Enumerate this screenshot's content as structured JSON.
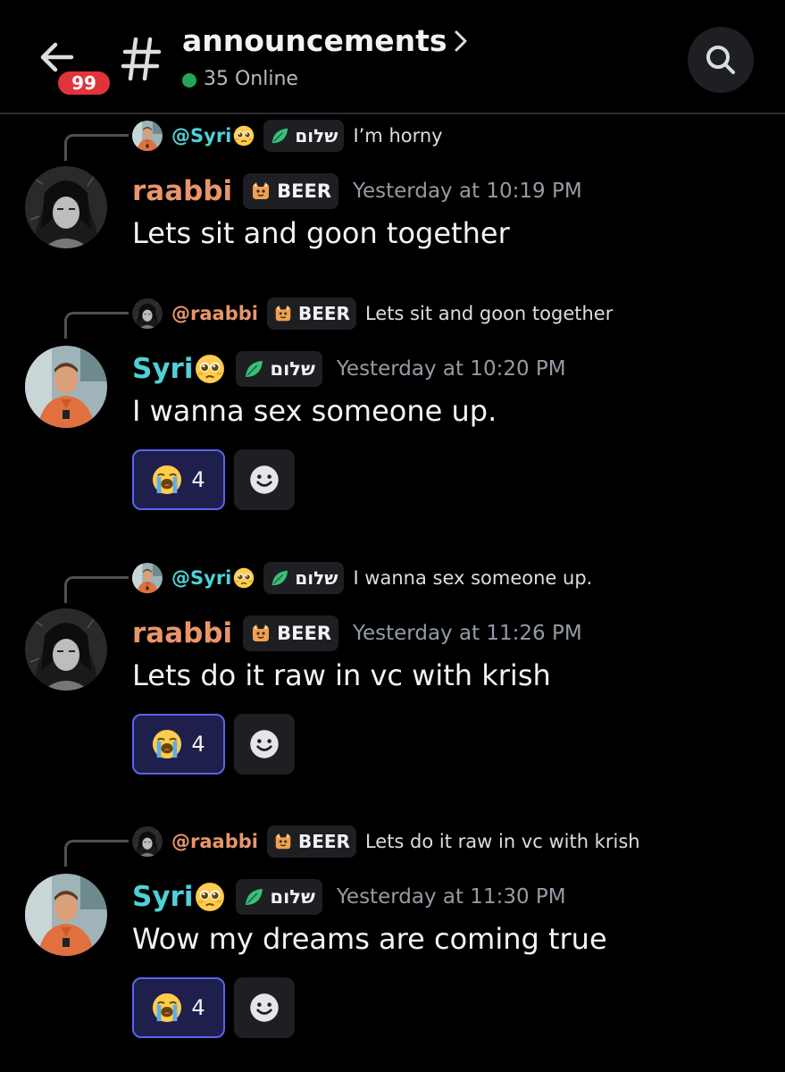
{
  "header": {
    "channel_name": "announcements",
    "online_text": "35 Online",
    "unread_badge": "99"
  },
  "messages": [
    {
      "reply_to": {
        "name": "@Syri",
        "tag": "שלום",
        "text": "I’m horny"
      },
      "author": "raabbi",
      "tag": "BEER",
      "timestamp": "Yesterday at 10:19 PM",
      "content": "Lets sit and goon together"
    },
    {
      "reply_to": {
        "name": "@raabbi",
        "tag": "BEER",
        "text": "Lets sit and goon together"
      },
      "author": "Syri",
      "tag": "שלום",
      "timestamp": "Yesterday at 10:20 PM",
      "content": "I wanna sex someone up.",
      "reaction_count": "4"
    },
    {
      "reply_to": {
        "name": "@Syri",
        "tag": "שלום",
        "text": "I wanna sex someone up."
      },
      "author": "raabbi",
      "tag": "BEER",
      "timestamp": "Yesterday at 11:26 PM",
      "content": "Lets do it raw in vc with krish",
      "reaction_count": "4"
    },
    {
      "reply_to": {
        "name": "@raabbi",
        "tag": "BEER",
        "text": "Lets do it raw in vc with krish"
      },
      "author": "Syri",
      "tag": "שלום",
      "timestamp": "Yesterday at 11:30 PM",
      "content": "Wow my dreams are coming true",
      "reaction_count": "4"
    }
  ],
  "colors": {
    "raabbi": "#e8956a",
    "syri": "#4fd1d9",
    "reaction_border": "#5865f2",
    "online": "#23a55a",
    "badge": "#e0333b"
  },
  "icons": {
    "back": "arrow-left-icon",
    "channel": "hash-icon",
    "search": "search-icon",
    "reaction": "loudly-crying-face-emoji",
    "add_reaction": "smiley-add-reaction-icon"
  }
}
